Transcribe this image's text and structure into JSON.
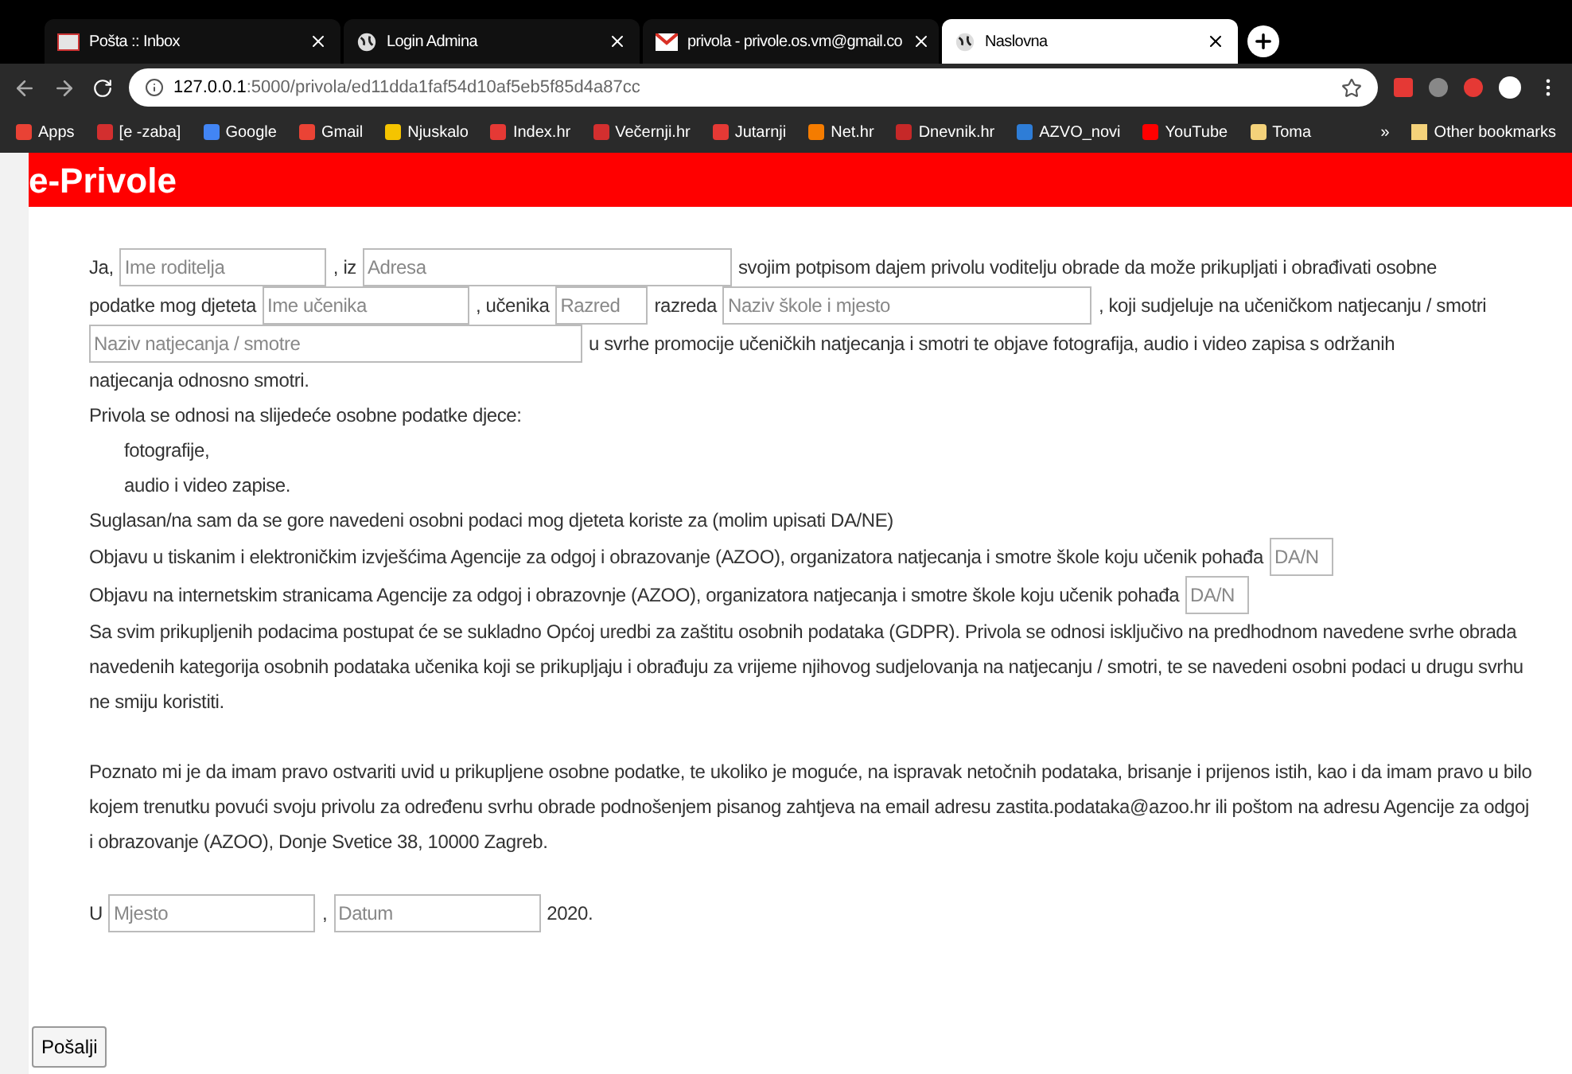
{
  "browser": {
    "tabs": [
      {
        "title": "Pošta :: Inbox",
        "kind": "mail",
        "selected": false
      },
      {
        "title": "Login Admina",
        "kind": "web",
        "selected": false
      },
      {
        "title": "privola - privole.os.vm@gmail.co",
        "kind": "gmail",
        "selected": false
      },
      {
        "title": "Naslovna",
        "kind": "web",
        "selected": true
      }
    ],
    "url_host": "127.0.0.1",
    "url_path": ":5000/privola/ed11dda1faf54d10af5eb5f85d4a87cc",
    "bookmarks": [
      {
        "label": "Apps",
        "color": "#e94235"
      },
      {
        "label": "[e -zaba]",
        "color": "#d32f2f"
      },
      {
        "label": "Google",
        "color": "#4285f4"
      },
      {
        "label": "Gmail",
        "color": "#ea4335"
      },
      {
        "label": "Njuskalo",
        "color": "#f5c400"
      },
      {
        "label": "Index.hr",
        "color": "#e53935"
      },
      {
        "label": "Večernji.hr",
        "color": "#d32f2f"
      },
      {
        "label": "Jutarnji",
        "color": "#e53935"
      },
      {
        "label": "Net.hr",
        "color": "#f57c00"
      },
      {
        "label": "Dnevnik.hr",
        "color": "#c62828"
      },
      {
        "label": "AZVO_novi",
        "color": "#2e7dd7"
      },
      {
        "label": "YouTube",
        "color": "#ff0000"
      },
      {
        "label": "Toma",
        "color": "#f4d27a"
      }
    ],
    "overflow": "»",
    "other_bookmarks": "Other bookmarks"
  },
  "header": {
    "title": "e-Privole"
  },
  "form": {
    "lines": [
      {
        "parts": [
          {
            "kind": "text",
            "text": "Ja,"
          },
          {
            "kind": "field",
            "placeholder": "Ime roditelja"
          },
          {
            "kind": "text",
            "text": ", iz"
          },
          {
            "kind": "field",
            "placeholder": "Adresa"
          },
          {
            "kind": "text",
            "text": "svojim potpisom dajem privolu voditelju obrade da može prikupljati i obrađivati osobne"
          }
        ]
      },
      {
        "parts": [
          {
            "kind": "text",
            "text": "podatke mog djeteta"
          },
          {
            "kind": "field",
            "placeholder": "Ime učenika"
          },
          {
            "kind": "text",
            "text": ", učenika"
          },
          {
            "kind": "field",
            "placeholder": "Razred"
          },
          {
            "kind": "text",
            "text": "razreda"
          },
          {
            "kind": "field",
            "placeholder": "Naziv škole i mjesto"
          },
          {
            "kind": "text",
            "text": ", koji sudjeluje na učeničkom natjecanju / smotri"
          }
        ]
      },
      {
        "parts": [
          {
            "kind": "field",
            "placeholder": "Naziv natjecanja / smotre"
          },
          {
            "kind": "text",
            "text": "u svrhe promocije učeničkih natjecanja i smotri te objave fotografija, audio i video zapisa s održanih"
          }
        ]
      },
      {
        "parts": [
          {
            "kind": "text",
            "text": "natjecanja odnosno smotri."
          }
        ]
      },
      {
        "parts": [
          {
            "kind": "text",
            "text": "Privola se odnosi na slijedeće osobne podatke djece:"
          }
        ]
      },
      {
        "kind": "item",
        "parts": [
          {
            "kind": "text",
            "text": "fotografije,"
          }
        ]
      },
      {
        "kind": "item",
        "parts": [
          {
            "kind": "text",
            "text": "audio i video zapise."
          }
        ]
      },
      {
        "parts": [
          {
            "kind": "text",
            "text": "Suglasan/na sam da se gore navedeni osobni podaci mog djeteta koriste za (molim upisati DA/NE)"
          }
        ]
      },
      {
        "parts": [
          {
            "kind": "text",
            "text": "Objavu u tiskanim i elektroničkim izvješćima Agencije za odgoj i obrazovanje (AZOO), organizatora natjecanja i smotre škole koju učenik pohađa"
          },
          {
            "kind": "field",
            "placeholder": "DA/N"
          }
        ]
      },
      {
        "parts": [
          {
            "kind": "text",
            "text": "Objavu na internetskim stranicama Agencije za odgoj i obrazovnje (AZOO), organizatora natjecanja i smotre škole koju učenik pohađa"
          },
          {
            "kind": "field",
            "placeholder": "DA/N"
          }
        ]
      }
    ],
    "paragraphs": [
      "Sa svim prikupljenih podacima postupat će se sukladno Općoj uredbi za zaštitu osobnih podataka (GDPR). Privola se odnosi isključivo na predhodnom navedene svrhe obrada navedenih kategorija osobnih podataka učenika koji se prikupljaju i obrađuju za vrijeme njihovog sudjelovanja na natjecanju / smotri, te se navedeni osobni podaci u drugu svrhu ne smiju koristiti.",
      "Poznato mi je da imam pravo ostvariti uvid u prikupljene osobne podatke, te ukoliko je moguće, na ispravak netočnih podataka, brisanje i prijenos istih, kao i da imam pravo u bilo kojem trenutku povući svoju privolu za određenu svrhu obrade podnošenjem pisanog zahtjeva na email adresu zastita.podataka@azoo.hr ili poštom na adresu Agencije za odgoj i obrazovanje (AZOO), Donje Svetice 38, 10000 Zagreb."
    ],
    "signature": {
      "parts": [
        {
          "kind": "text",
          "text": "U"
        },
        {
          "kind": "field",
          "placeholder": "Mjesto"
        },
        {
          "kind": "text",
          "text": ","
        },
        {
          "kind": "field",
          "placeholder": "Datum"
        },
        {
          "kind": "text",
          "text": "2020."
        }
      ]
    },
    "submit": "Pošalji"
  }
}
